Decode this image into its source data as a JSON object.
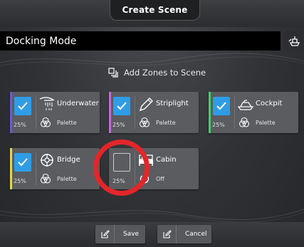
{
  "header": {
    "title": "Create Scene"
  },
  "scene_name_input": {
    "value": "Docking Mode"
  },
  "add_zones": {
    "label": "Add Zones to Scene"
  },
  "zones": [
    {
      "name": "Underwater",
      "level": "25%",
      "sub": "Palette",
      "selected": true,
      "bar_color": "#6a5ad8",
      "icon": "shower-icon"
    },
    {
      "name": "Striplight",
      "level": "25%",
      "sub": "Palette",
      "selected": true,
      "bar_color": "#c86ad8",
      "icon": "pencil-icon"
    },
    {
      "name": "Cockpit",
      "level": "25%",
      "sub": "Palette",
      "selected": true,
      "bar_color": "#3fd26a",
      "icon": "boat-icon"
    },
    {
      "name": "Bridge",
      "level": "25%",
      "sub": "Palette",
      "selected": true,
      "bar_color": "#e3d84a",
      "icon": "helm-wheel-icon"
    },
    {
      "name": "Cabin",
      "level": "25%",
      "sub": "Off",
      "selected": false,
      "bar_color": "#5a5c60",
      "icon": "bed-icon"
    }
  ],
  "footer": {
    "save_label": "Save",
    "cancel_label": "Cancel"
  },
  "colors": {
    "accent": "#2f9de6",
    "highlight_circle": "#e3262a"
  }
}
